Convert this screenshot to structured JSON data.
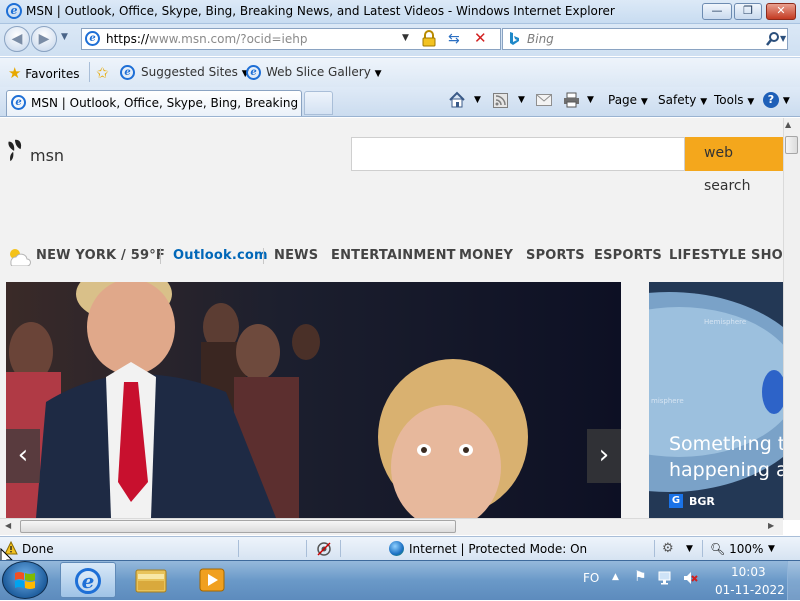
{
  "window": {
    "title": "MSN | Outlook, Office, Skype, Bing, Breaking News, and Latest Videos - Windows Internet Explorer",
    "minimize": "—",
    "restore": "❐",
    "close": "✕"
  },
  "address": {
    "url_scheme": "https://",
    "url_host": "www.msn.com",
    "url_path": "/?ocid=iehp",
    "search_placeholder": "Bing"
  },
  "favorites_bar": {
    "favorites": "Favorites",
    "suggested_sites": "Suggested Sites",
    "web_slice_gallery": "Web Slice Gallery"
  },
  "tabs": {
    "active_tab": "MSN | Outlook, Office, Skype, Bing, Breaking Ne..."
  },
  "command_bar": {
    "page": "Page",
    "safety": "Safety",
    "tools": "Tools"
  },
  "msn": {
    "logo_text": "msn",
    "search_button": "web search",
    "weather": "NEW YORK / 59°F",
    "nav": [
      "Outlook.com",
      "NEWS",
      "ENTERTAINMENT",
      "MONEY",
      "SPORTS",
      "ESPORTS",
      "LIFESTYLE",
      "SHOP"
    ],
    "side_headline_line1": "Something to",
    "side_headline_line2": "happening at",
    "side_source": "BGR",
    "side_image_text_1": "Hemisphere",
    "side_image_text_2": "misphere"
  },
  "status_bar": {
    "done": "Done",
    "zone": "Internet | Protected Mode: On",
    "zoom": "100%"
  },
  "taskbar": {
    "lang": "FO",
    "time": "10:03",
    "date": "01-11-2022"
  },
  "colors": {
    "accent_orange": "#f4a71c",
    "outlook_blue": "#0067b8",
    "ie_blue": "#1e6fd6"
  }
}
